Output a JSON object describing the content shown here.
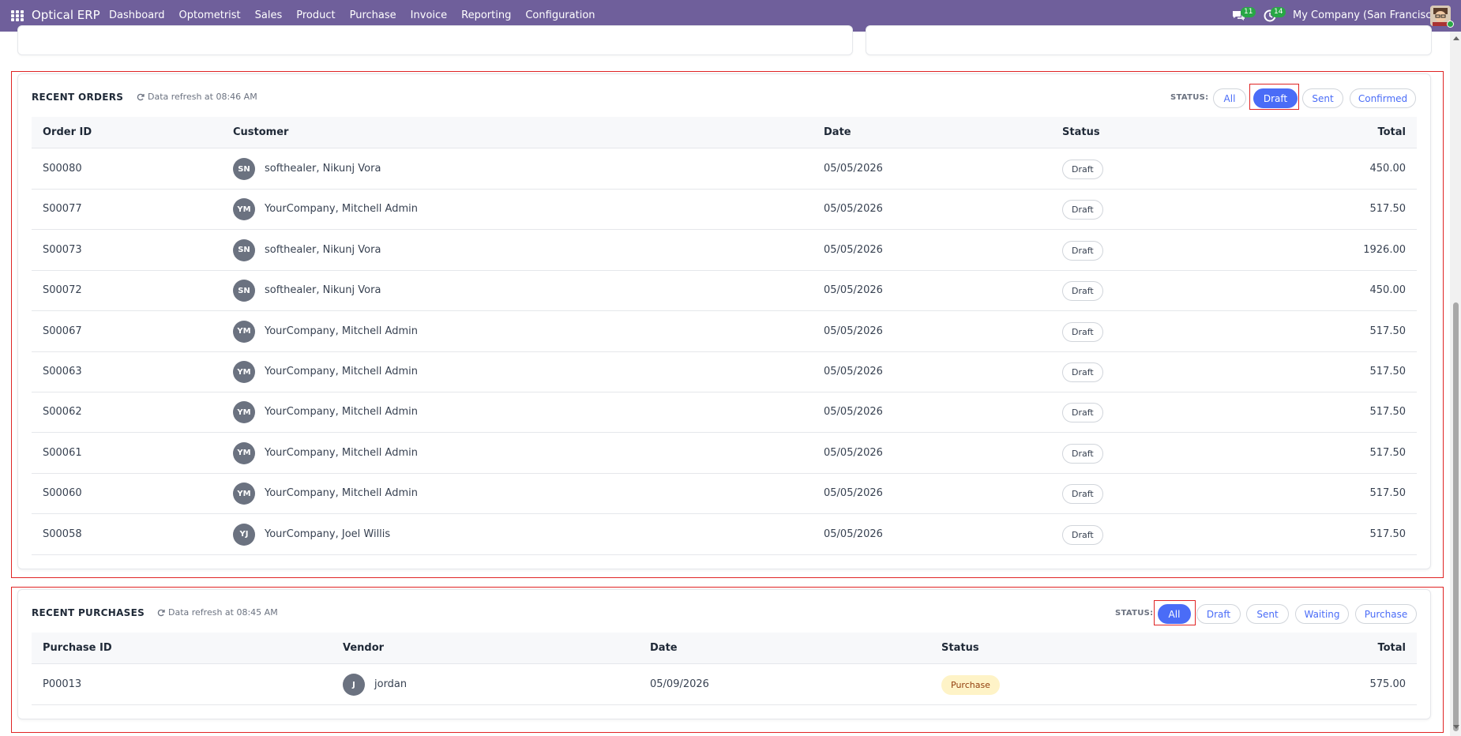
{
  "navbar": {
    "brand": "Optical ERP",
    "menu": [
      "Dashboard",
      "Optometrist",
      "Sales",
      "Product",
      "Purchase",
      "Invoice",
      "Reporting",
      "Configuration"
    ],
    "messages_count": "11",
    "activities_count": "14",
    "company": "My Company (San Francisco)",
    "bg_color": "#6f5f9b"
  },
  "orders": {
    "title": "RECENT ORDERS",
    "refresh": "Data refresh at 08:46 AM",
    "status_label": "STATUS:",
    "filters": [
      "All",
      "Draft",
      "Sent",
      "Confirmed"
    ],
    "active_filter": "Draft",
    "columns": [
      "Order ID",
      "Customer",
      "Date",
      "Status",
      "Total"
    ],
    "rows": [
      {
        "id": "S00080",
        "initials": "SN",
        "customer": "softhealer, Nikunj Vora",
        "date": "05/05/2026",
        "status": "Draft",
        "total": "450.00"
      },
      {
        "id": "S00077",
        "initials": "YM",
        "customer": "YourCompany, Mitchell Admin",
        "date": "05/05/2026",
        "status": "Draft",
        "total": "517.50"
      },
      {
        "id": "S00073",
        "initials": "SN",
        "customer": "softhealer, Nikunj Vora",
        "date": "05/05/2026",
        "status": "Draft",
        "total": "1926.00"
      },
      {
        "id": "S00072",
        "initials": "SN",
        "customer": "softhealer, Nikunj Vora",
        "date": "05/05/2026",
        "status": "Draft",
        "total": "450.00"
      },
      {
        "id": "S00067",
        "initials": "YM",
        "customer": "YourCompany, Mitchell Admin",
        "date": "05/05/2026",
        "status": "Draft",
        "total": "517.50"
      },
      {
        "id": "S00063",
        "initials": "YM",
        "customer": "YourCompany, Mitchell Admin",
        "date": "05/05/2026",
        "status": "Draft",
        "total": "517.50"
      },
      {
        "id": "S00062",
        "initials": "YM",
        "customer": "YourCompany, Mitchell Admin",
        "date": "05/05/2026",
        "status": "Draft",
        "total": "517.50"
      },
      {
        "id": "S00061",
        "initials": "YM",
        "customer": "YourCompany, Mitchell Admin",
        "date": "05/05/2026",
        "status": "Draft",
        "total": "517.50"
      },
      {
        "id": "S00060",
        "initials": "YM",
        "customer": "YourCompany, Mitchell Admin",
        "date": "05/05/2026",
        "status": "Draft",
        "total": "517.50"
      },
      {
        "id": "S00058",
        "initials": "YJ",
        "customer": "YourCompany, Joel Willis",
        "date": "05/05/2026",
        "status": "Draft",
        "total": "517.50"
      }
    ]
  },
  "purchases": {
    "title": "RECENT PURCHASES",
    "refresh": "Data refresh at 08:45 AM",
    "status_label": "STATUS:",
    "filters": [
      "All",
      "Draft",
      "Sent",
      "Waiting",
      "Purchase"
    ],
    "active_filter": "All",
    "columns": [
      "Purchase ID",
      "Vendor",
      "Date",
      "Status",
      "Total"
    ],
    "rows": [
      {
        "id": "P00013",
        "initials": "J",
        "vendor": "jordan",
        "date": "05/09/2026",
        "status": "Purchase",
        "total": "575.00"
      }
    ]
  },
  "colors": {
    "accent": "#4a6cf7",
    "highlight": "#e02424",
    "purchase_chip": "#fef3c7"
  }
}
